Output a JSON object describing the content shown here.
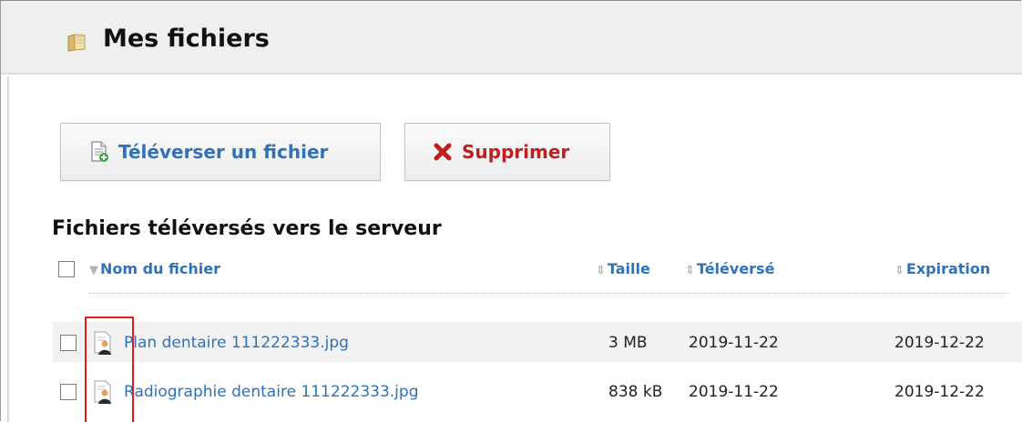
{
  "header": {
    "title": "Mes fichiers",
    "icon": "folder-icon"
  },
  "toolbar": {
    "upload_label": "Téléverser un fichier",
    "delete_label": "Supprimer"
  },
  "section": {
    "title": "Fichiers téléversés vers le serveur"
  },
  "table": {
    "columns": [
      "Nom du fichier",
      "Taille",
      "Téléversé",
      "Expiration"
    ],
    "rows": [
      {
        "name": "Plan dentaire 111222333.jpg",
        "size": "3 MB",
        "uploaded": "2019-11-22",
        "expiration": "2019-12-22"
      },
      {
        "name": "Radiographie dentaire 111222333.jpg",
        "size": "838 kB",
        "uploaded": "2019-11-22",
        "expiration": "2019-12-22"
      }
    ]
  },
  "colors": {
    "link": "#2f72b8",
    "delete": "#c01f1f",
    "highlight": "#e31b1b",
    "title_bar": "#efefef"
  }
}
